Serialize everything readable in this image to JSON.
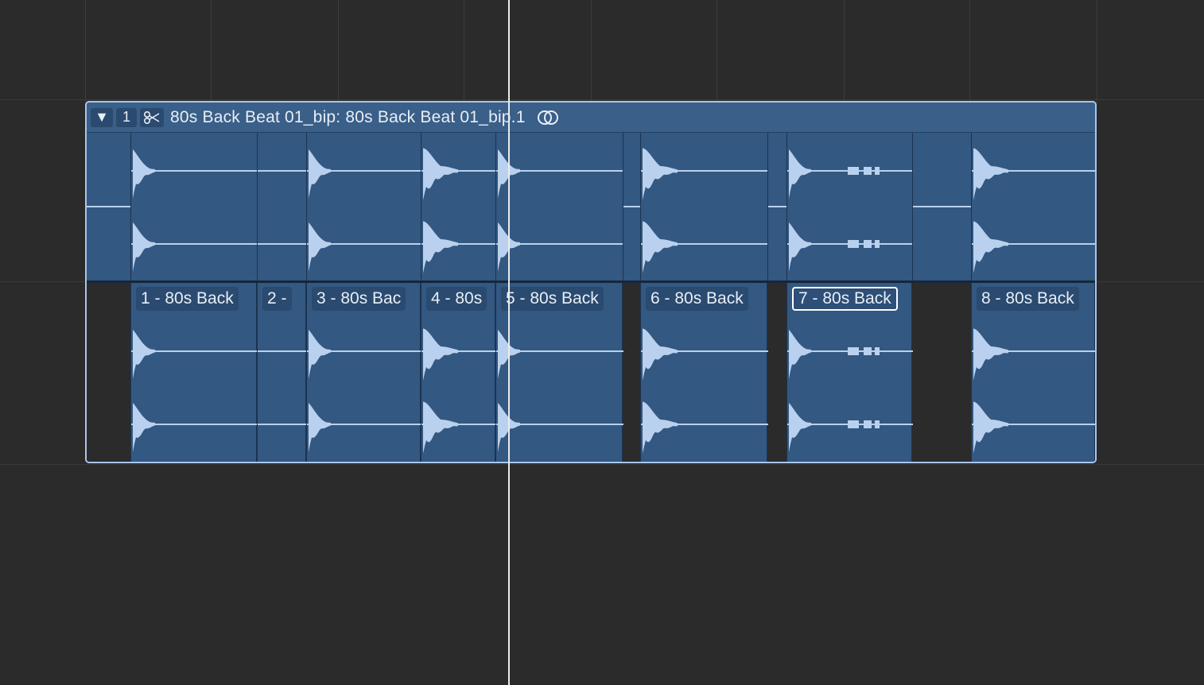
{
  "region": {
    "disclosure_symbol": "▼",
    "take_number": "1",
    "title": "80s Back Beat 01_bip: 80s Back Beat 01_bip.1"
  },
  "icons": {
    "disclosure": "triangle-down-icon",
    "scissors": "scissors-icon",
    "link": "link-rings-icon"
  },
  "slices": [
    {
      "label": "1 - 80s Back"
    },
    {
      "label": "2 -"
    },
    {
      "label": "3 - 80s Bac"
    },
    {
      "label": "4 - 80s"
    },
    {
      "label": "5 - 80s Back"
    },
    {
      "label": "6 - 80s Back"
    },
    {
      "label": "7 - 80s Back",
      "selected": true
    },
    {
      "label": "8 - 80s Back"
    }
  ],
  "colors": {
    "background": "#2b2b2b",
    "region_fill": "#335881",
    "region_border": "#a9c6ec",
    "waveform": "#b9d1ee",
    "playhead": "#ececec"
  }
}
